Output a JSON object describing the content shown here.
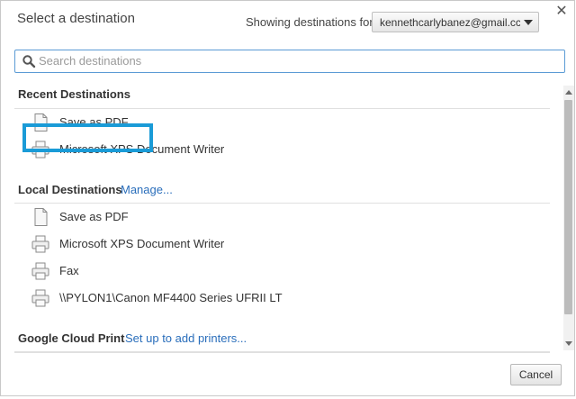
{
  "dialog": {
    "title": "Select a destination",
    "showing_label": "Showing destinations for",
    "account_value": "kennethcarlybanez@gmail.cc",
    "search_placeholder": "Search destinations",
    "cancel_label": "Cancel"
  },
  "recent": {
    "heading": "Recent Destinations",
    "items": [
      {
        "label": "Save as PDF",
        "icon": "document-icon"
      },
      {
        "label": "Microsoft XPS Document Writer",
        "icon": "printer-icon"
      }
    ]
  },
  "local": {
    "heading": "Local Destinations",
    "manage_link": "Manage...",
    "items": [
      {
        "label": "Save as PDF",
        "icon": "document-icon"
      },
      {
        "label": "Microsoft XPS Document Writer",
        "icon": "printer-icon"
      },
      {
        "label": "Fax",
        "icon": "printer-icon"
      },
      {
        "label": "\\\\PYLON1\\Canon MF4400 Series UFRII LT",
        "icon": "printer-icon"
      }
    ]
  },
  "cloud": {
    "heading": "Google Cloud Print",
    "setup_link": "Set up to add printers..."
  },
  "colors": {
    "highlight": "#1a9bd7",
    "link": "#2a6ebb",
    "search_border": "#5b9bd5"
  }
}
